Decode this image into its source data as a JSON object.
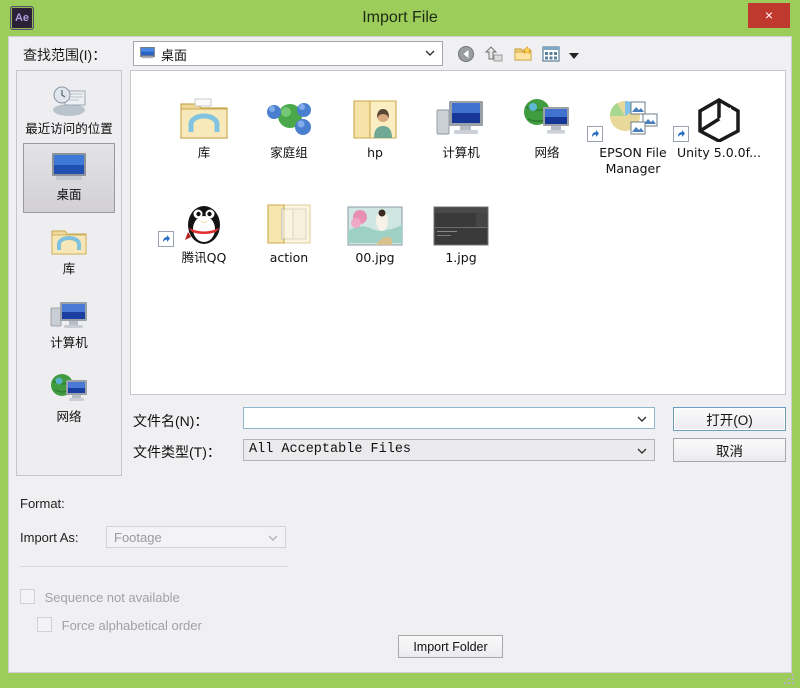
{
  "window": {
    "title": "Import File",
    "app_icon_label": "Ae",
    "close_label": "×",
    "accent_color": "#9ccc5a",
    "close_color": "#c0392f"
  },
  "lookin": {
    "label": "查找范围(I)：",
    "value": "桌面",
    "icon": "monitor-icon"
  },
  "toolbar": {
    "buttons": [
      {
        "name": "back-button",
        "icon": "back-arrow-icon"
      },
      {
        "name": "up-folder-button",
        "icon": "up-folder-icon"
      },
      {
        "name": "new-folder-button",
        "icon": "new-folder-icon"
      },
      {
        "name": "view-mode-button",
        "icon": "views-grid-icon"
      }
    ]
  },
  "places": [
    {
      "label": "最近访问的位置",
      "icon": "recent-places-icon",
      "selected": false
    },
    {
      "label": "桌面",
      "icon": "desktop-icon",
      "selected": true
    },
    {
      "label": "库",
      "icon": "libraries-icon",
      "selected": false
    },
    {
      "label": "计算机",
      "icon": "computer-icon",
      "selected": false
    },
    {
      "label": "网络",
      "icon": "network-icon",
      "selected": false
    }
  ],
  "files": [
    {
      "name": "库",
      "icon": "libraries-folder-icon",
      "shortcut": false
    },
    {
      "name": "家庭组",
      "icon": "homegroup-icon",
      "shortcut": false
    },
    {
      "name": "hp",
      "icon": "user-folder-icon",
      "shortcut": false
    },
    {
      "name": "计算机",
      "icon": "computer-icon",
      "shortcut": false
    },
    {
      "name": "网络",
      "icon": "network-icon",
      "shortcut": false
    },
    {
      "name": "EPSON File Manager",
      "icon": "epson-file-manager-icon",
      "shortcut": true
    },
    {
      "name": "Unity 5.0.0f...",
      "icon": "unity-icon",
      "shortcut": true
    },
    {
      "name": "腾讯QQ",
      "icon": "qq-penguin-icon",
      "shortcut": true
    },
    {
      "name": "action",
      "icon": "folder-icon",
      "shortcut": false
    },
    {
      "name": "00.jpg",
      "icon": "image-thumbnail-icon",
      "shortcut": false
    },
    {
      "name": "1.jpg",
      "icon": "screenshot-thumbnail-icon",
      "shortcut": false
    }
  ],
  "filename": {
    "label": "文件名(N)：",
    "value": "",
    "placeholder": ""
  },
  "filetype": {
    "label": "文件类型(T)：",
    "value": "All Acceptable Files"
  },
  "buttons": {
    "open": "打开(O)",
    "cancel": "取消",
    "import_folder": "Import Folder"
  },
  "options": {
    "format_label": "Format:",
    "format_value": "",
    "import_as_label": "Import As:",
    "import_as_value": "Footage",
    "sequence_label": "Sequence not available",
    "sequence_checked": false,
    "force_alpha_label": "Force alphabetical order",
    "force_alpha_checked": false
  }
}
